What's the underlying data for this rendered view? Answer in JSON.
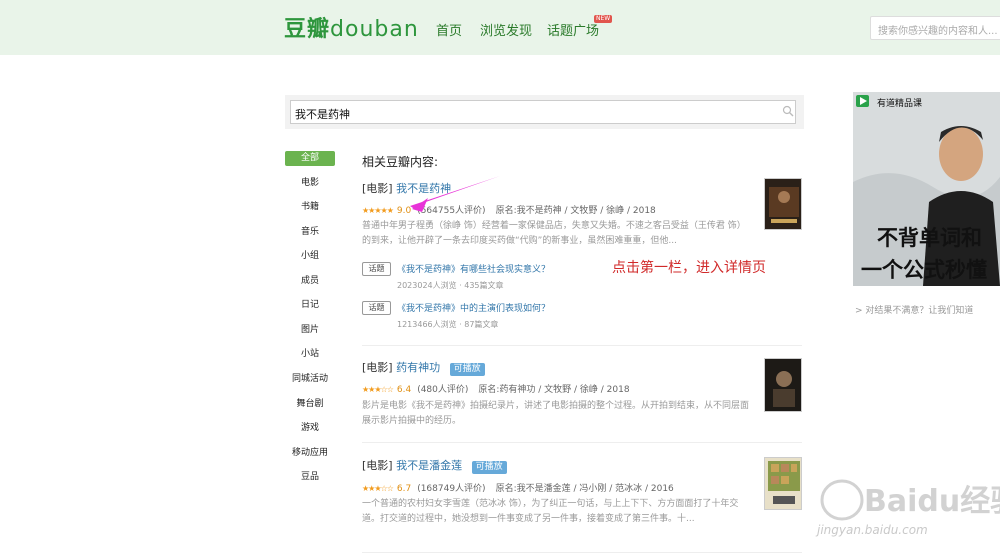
{
  "header": {
    "logo_cn": "豆瓣",
    "logo_latin": "douban",
    "nav": [
      "首页",
      "浏览发现",
      "话题广场"
    ],
    "nav_new_badge": "NEW",
    "search_placeholder": "搜索你感兴趣的内容和人..."
  },
  "search": {
    "value": "我不是药神"
  },
  "categories": [
    "全部",
    "电影",
    "书籍",
    "音乐",
    "小组",
    "成员",
    "日记",
    "图片",
    "小站",
    "同城活动",
    "舞台剧",
    "游戏",
    "移动应用",
    "豆品"
  ],
  "section_title": "相关豆瓣内容:",
  "results": [
    {
      "type": "[电影]",
      "title": "我不是药神",
      "badge": "",
      "rating": 9.0,
      "rating_text": "9.0",
      "votes": "(564755人评价)",
      "info": "原名:我不是药神 / 文牧野 / 徐峥 / 2018",
      "desc": "普通中年男子程勇（徐峥 饰）经营着一家保健品店，失意又失婚。不速之客吕受益（王传君 饰）的到来，让他开辟了一条去印度买药做“代购”的新事业，虽然困难重重，但他..."
    },
    {
      "type": "[电影]",
      "title": "药有神功",
      "badge": "可播放",
      "rating": 6.4,
      "rating_text": "6.4",
      "votes": "(480人评价)",
      "info": "原名:药有神功 / 文牧野 / 徐峥 / 2018",
      "desc": "影片是电影《我不是药神》拍摄纪录片，讲述了电影拍摄的整个过程。从开拍到结束，从不同层面展示影片拍摄中的经历。"
    },
    {
      "type": "[电影]",
      "title": "我不是潘金莲",
      "badge": "可播放",
      "rating": 6.7,
      "rating_text": "6.7",
      "votes": "(168749人评价)",
      "info": "原名:我不是潘金莲 / 冯小刚 / 范冰冰 / 2016",
      "desc": "一个普通的农村妇女李雪莲（范冰冰 饰），为了纠正一句话，与上上下下、方方面面打了十年交道。打交道的过程中，她没想到一件事变成了另一件事，接着变成了第三件事。十..."
    }
  ],
  "topics": [
    {
      "tag": "话题",
      "title": "《我不是药神》有哪些社会现实意义？",
      "meta": "2023024人浏览 · 435篇文章"
    },
    {
      "tag": "话题",
      "title": "《我不是药神》中的主演们表现如何？",
      "meta": "1213466人浏览 · 87篇文章"
    }
  ],
  "annotation": "点击第一栏，进入详情页",
  "ad": {
    "brand": "有道精品课",
    "line1": "不背单词和",
    "line2": "一个公式秒懂"
  },
  "feedback": "> 对结果不满意？让我们知道",
  "watermark": {
    "text": "Baidu经验",
    "url": "jingyan.baidu.com"
  },
  "colors": {
    "header_bg": "#e9f4e9",
    "brand_green": "#2e963d",
    "link": "#3377aa",
    "star": "#f29b1d",
    "annotation": "#d12a2a",
    "arrow": "#e833d8"
  },
  "icons": [
    "search-icon",
    "play-icon",
    "arrow-annotation"
  ]
}
